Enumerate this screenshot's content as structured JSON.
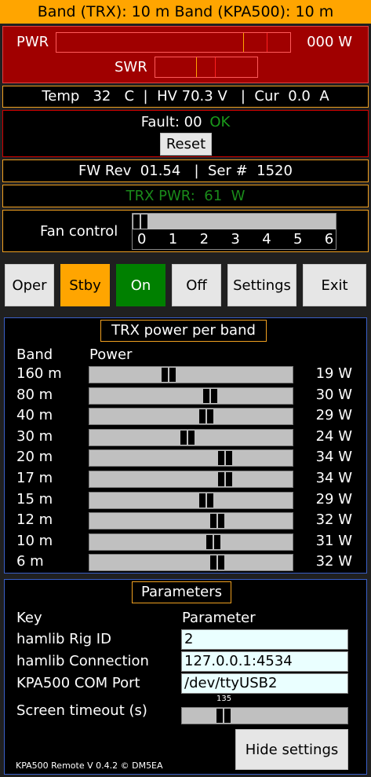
{
  "header": {
    "band_text": "Band (TRX): 10 m  Band (KPA500): 10 m"
  },
  "power": {
    "pwr_label": "PWR",
    "pwr_value": "000 W",
    "swr_label": "SWR"
  },
  "status": {
    "text": "Temp   32   C  |  HV 70.3 V   |  Cur  0.0  A"
  },
  "fault": {
    "label": "Fault:  00",
    "state": "OK",
    "reset_label": "Reset"
  },
  "firmware": {
    "text": "FW Rev  01.54   |  Ser #  1520"
  },
  "trx_power": {
    "text": "TRX PWR:  61  W"
  },
  "fan": {
    "label": "Fan control",
    "ticks": [
      "0",
      "1",
      "2",
      "3",
      "4",
      "5",
      "6"
    ],
    "level": 0
  },
  "buttons": [
    {
      "label": "Oper",
      "color": "#e6e6e6",
      "text": "#000000"
    },
    {
      "label": "Stby",
      "color": "#ffa500",
      "text": "#000000"
    },
    {
      "label": "On",
      "color": "#008000",
      "text": "#ffffff"
    },
    {
      "label": "Off",
      "color": "#e6e6e6",
      "text": "#000000"
    },
    {
      "label": "Settings",
      "color": "#e6e6e6",
      "text": "#000000"
    },
    {
      "label": "Exit",
      "color": "#e6e6e6",
      "text": "#000000"
    }
  ],
  "band_power": {
    "title": "TRX power per band",
    "col_band": "Band",
    "col_power": "Power",
    "rows": [
      {
        "band": "160 m",
        "value": "19 W",
        "level": 19
      },
      {
        "band": "80 m",
        "value": "30 W",
        "level": 30
      },
      {
        "band": "40 m",
        "value": "29 W",
        "level": 29
      },
      {
        "band": "30 m",
        "value": "24 W",
        "level": 24
      },
      {
        "band": "20 m",
        "value": "34 W",
        "level": 34
      },
      {
        "band": "17 m",
        "value": "34 W",
        "level": 34
      },
      {
        "band": "15 m",
        "value": "29 W",
        "level": 29
      },
      {
        "band": "12 m",
        "value": "32 W",
        "level": 32
      },
      {
        "band": "10 m",
        "value": "31 W",
        "level": 31
      },
      {
        "band": "6 m",
        "value": "32 W",
        "level": 32
      }
    ]
  },
  "parameters": {
    "title": "Parameters",
    "col_key": "Key",
    "col_param": "Parameter",
    "rig_id_label": "hamlib Rig ID",
    "rig_id_value": "2",
    "connection_label": "hamlib Connection",
    "connection_value": "127.0.0.1:4534",
    "com_label": "KPA500 COM Port",
    "com_value": "/dev/ttyUSB2",
    "timeout_label": "Screen timeout (s)",
    "timeout_value": "135",
    "hide_label": "Hide settings"
  },
  "footer": {
    "text": "KPA500 Remote V 0.4.2 © DM5EA"
  }
}
